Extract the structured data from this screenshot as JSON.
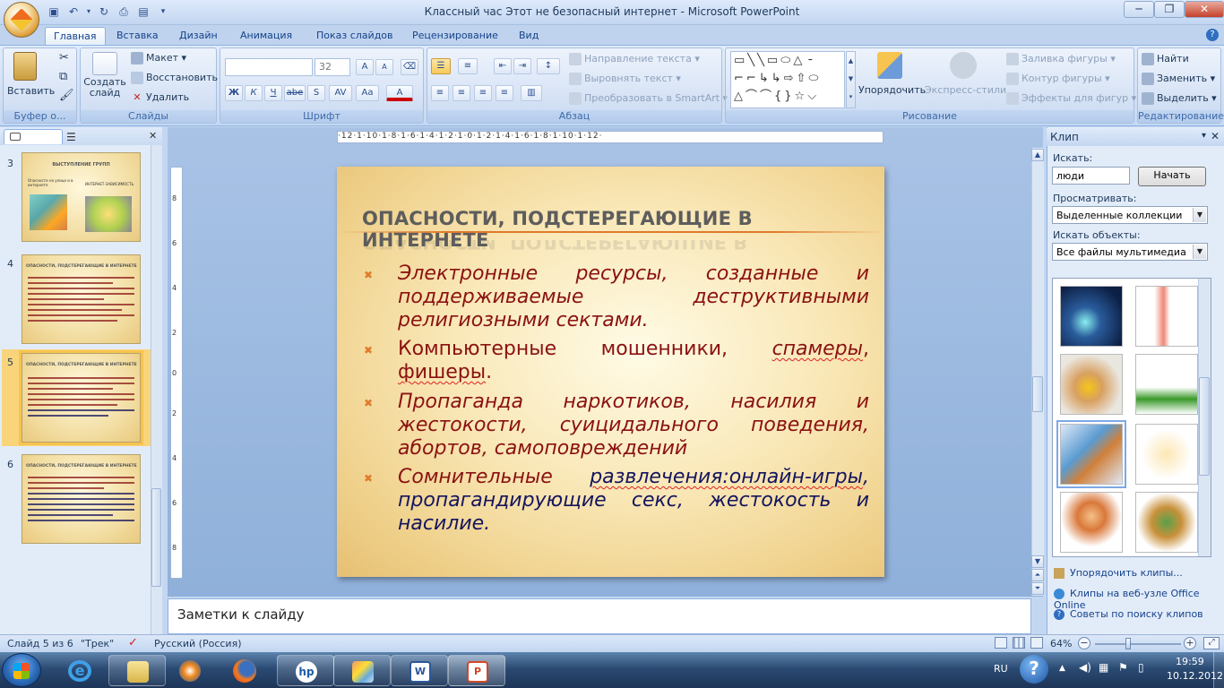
{
  "window": {
    "title": "Классный час Этот не безопасный интернет - Microsoft PowerPoint",
    "minimize": "─",
    "maximize": "❐",
    "close": "✕"
  },
  "ribbon_tabs": [
    "Главная",
    "Вставка",
    "Дизайн",
    "Анимация",
    "Показ слайдов",
    "Рецензирование",
    "Вид"
  ],
  "clipboard": {
    "paste": "Вставить",
    "label": "Буфер о..."
  },
  "slides_group": {
    "new_slide": "Создать слайд",
    "layout": "Макет",
    "reset": "Восстановить",
    "delete": "Удалить",
    "label": "Слайды"
  },
  "font_group": {
    "font_name": "",
    "font_size": "32",
    "bold": "Ж",
    "italic": "К",
    "underline": "Ч",
    "strike": "abe",
    "shadow": "S",
    "spacing": "AV",
    "case": "Aa",
    "color": "A",
    "grow": "A",
    "shrink": "A",
    "label": "Шрифт"
  },
  "paragraph_group": {
    "text_direction": "Направление текста",
    "align_text": "Выровнять текст",
    "smartart": "Преобразовать в SmartArt",
    "label": "Абзац"
  },
  "drawing_group": {
    "arrange": "Упорядочить",
    "quick_styles": "Экспресс-стили",
    "fill": "Заливка фигуры",
    "outline": "Контур фигуры",
    "effects": "Эффекты для фигур",
    "label": "Рисование"
  },
  "editing_group": {
    "find": "Найти",
    "replace": "Заменить",
    "select": "Выделить",
    "label": "Редактирование"
  },
  "thumbnails": [
    {
      "num": "3",
      "title": "ВЫСТУПЛЕНИЕ ГРУПП",
      "left_caption": "Опасности на улице и в интернете",
      "right_caption": "ИНТЕРНЕТ-ЗАВИСИМОСТЬ"
    },
    {
      "num": "4",
      "title": "ОПАСНОСТИ, ПОДСТЕРЕГАЮЩИЕ В ИНТЕРНЕТЕ"
    },
    {
      "num": "5",
      "title": "ОПАСНОСТИ, ПОДСТЕРЕГАЮЩИЕ В ИНТЕРНЕТЕ"
    },
    {
      "num": "6",
      "title": "ОПАСНОСТИ, ПОДСТЕРЕГАЮЩИЕ В ИНТЕРНЕТЕ"
    }
  ],
  "ruler": {
    "horizontal": "·12·1·10·1·8·1·6·1·4·1·2·1·0·1·2·1·4·1·6·1·8·1·10·1·12·",
    "vertical": [
      "8",
      "6",
      "4",
      "2",
      "0",
      "2",
      "4",
      "6",
      "8"
    ]
  },
  "slide": {
    "title": "ОПАСНОСТИ, ПОДСТЕРЕГАЮЩИЕ В ИНТЕРНЕТЕ",
    "bullet_marker": "✖",
    "b1": "Электронные ресурсы, созданные и поддерживаемые деструктивными религиозными сектами.",
    "b2_part1": "Компьютерные мошенники, ",
    "b2_part2": "спамеры",
    "b2_part3": ", ",
    "b2_part4": "фишеры",
    "b2_part5": ".",
    "b3": "Пропаганда наркотиков, насилия и жестокости, суицидального поведения, абортов, самоповреждений",
    "b4_part1": "Сомнительные ",
    "b4_part2": "развлечения:онлайн-игры",
    "b4_part3": ", пропагандирующие секс, жестокость и насилие."
  },
  "notes_placeholder": "Заметки к слайду",
  "clip_pane": {
    "title": "Клип",
    "search_label": "Искать:",
    "search_value": "люди",
    "search_button": "Начать",
    "browse_label": "Просматривать:",
    "browse_value": "Выделенные коллекции",
    "objects_label": "Искать объекты:",
    "objects_value": "Все файлы мультимедиа",
    "link_organize": "Упорядочить клипы...",
    "link_online": "Клипы на веб-узле Office Online",
    "link_tips": "Советы по поиску клипов"
  },
  "status": {
    "slide": "Слайд 5 из 6",
    "theme": "\"Трек\"",
    "language": "Русский (Россия)",
    "zoom": "64%"
  },
  "tray": {
    "lang": "RU",
    "time": "19:59",
    "date": "10.12.2012"
  },
  "colors": {
    "title_color": "#5d5d5d",
    "red_text": "#8b1212",
    "navy_text": "#15155e",
    "accent_orange": "#e07a2a"
  }
}
